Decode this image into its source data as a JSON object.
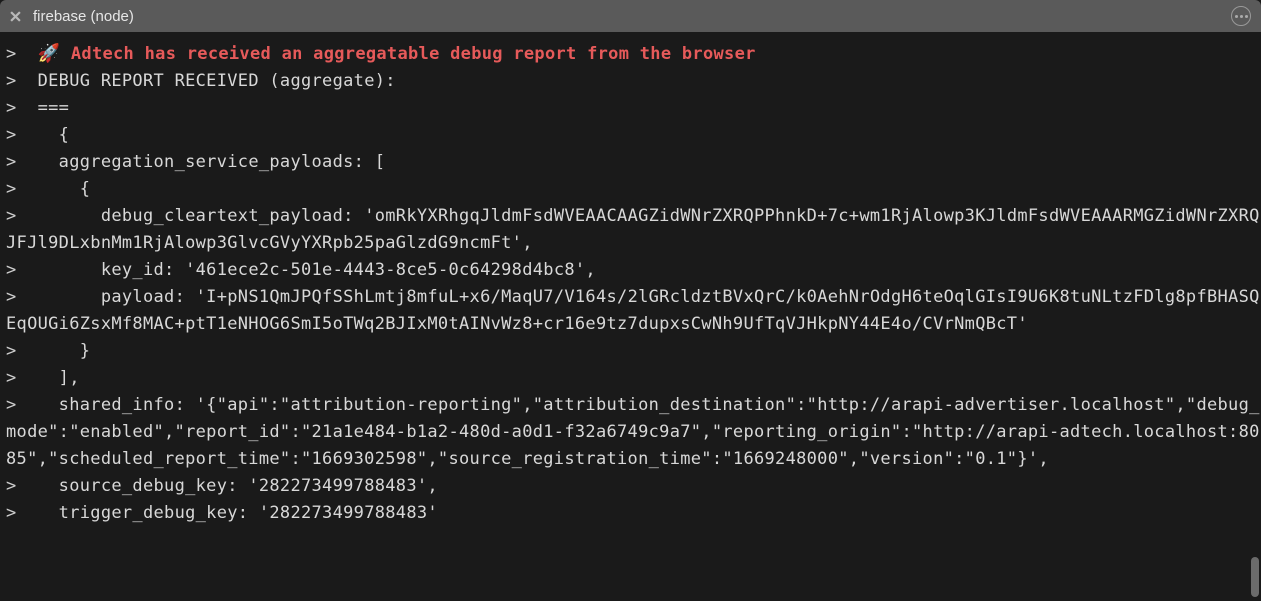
{
  "tab": {
    "title": "firebase (node)"
  },
  "terminal": {
    "prompt": ">",
    "headline_emoji": "🚀",
    "headline": " Adtech has received an aggregatable debug report from the browser",
    "lines": [
      "  DEBUG REPORT RECEIVED (aggregate):",
      "  ===",
      "    {",
      "    aggregation_service_payloads: [",
      "      {",
      "        debug_cleartext_payload: 'omRkYXRhgqJldmFsdWVEAACAAGZidWNrZXRQPPhnkD+7c+wm1RjAlowp3KJldmFsdWVEAAARMGZidWNrZXRQJFJl9DLxbnMm1RjAlowp3GlvcGVyYXRpb25paGlzdG9ncmFt',",
      "        key_id: '461ece2c-501e-4443-8ce5-0c64298d4bc8',",
      "        payload: 'I+pNS1QmJPQfSShLmtj8mfuL+x6/MaqU7/V164s/2lGRcldztBVxQrC/k0AehNrOdgH6teOqlGIsI9U6K8tuNLtzFDlg8pfBHASQEqOUGi6ZsxMf8MAC+ptT1eNHOG6SmI5oTWq2BJIxM0tAINvWz8+cr16e9tz7dupxsCwNh9UfTqVJHkpNY44E4o/CVrNmQBcT'",
      "      }",
      "    ],",
      "    shared_info: '{\"api\":\"attribution-reporting\",\"attribution_destination\":\"http://arapi-advertiser.localhost\",\"debug_mode\":\"enabled\",\"report_id\":\"21a1e484-b1a2-480d-a0d1-f32a6749c9a7\",\"reporting_origin\":\"http://arapi-adtech.localhost:8085\",\"scheduled_report_time\":\"1669302598\",\"source_registration_time\":\"1669248000\",\"version\":\"0.1\"}',",
      "    source_debug_key: '282273499788483',",
      "    trigger_debug_key: '282273499788483'"
    ]
  }
}
